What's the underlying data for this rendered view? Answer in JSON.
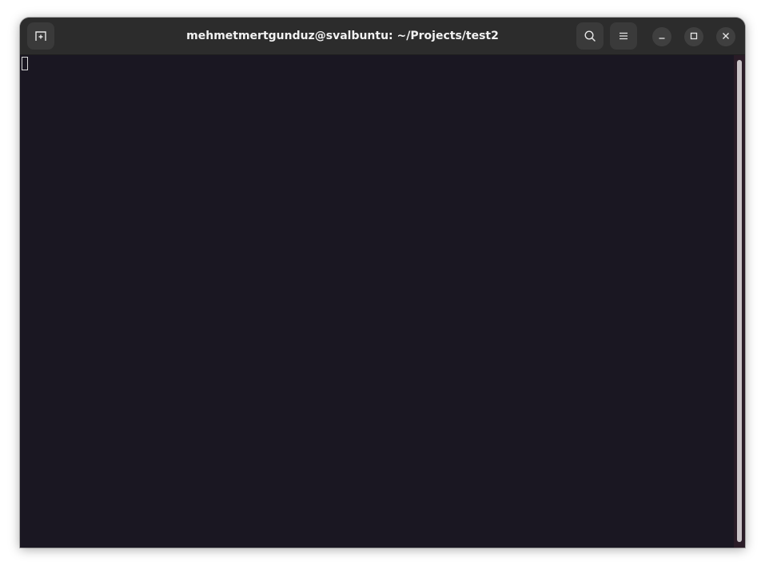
{
  "window": {
    "title": "mehmetmertgunduz@svalbuntu: ~/Projects/test2"
  },
  "icons": {
    "new_tab": "new-tab-icon",
    "search": "search-icon",
    "menu": "hamburger-menu-icon",
    "minimize": "minimize-icon",
    "maximize": "maximize-icon",
    "close": "close-icon"
  },
  "colors": {
    "titlebar_bg": "#2c2c2c",
    "terminal_bg": "#1a1722",
    "title_text": "#f2f2f2",
    "scrollbar_thumb": "#c9c3c7"
  },
  "terminal": {
    "output": ""
  }
}
